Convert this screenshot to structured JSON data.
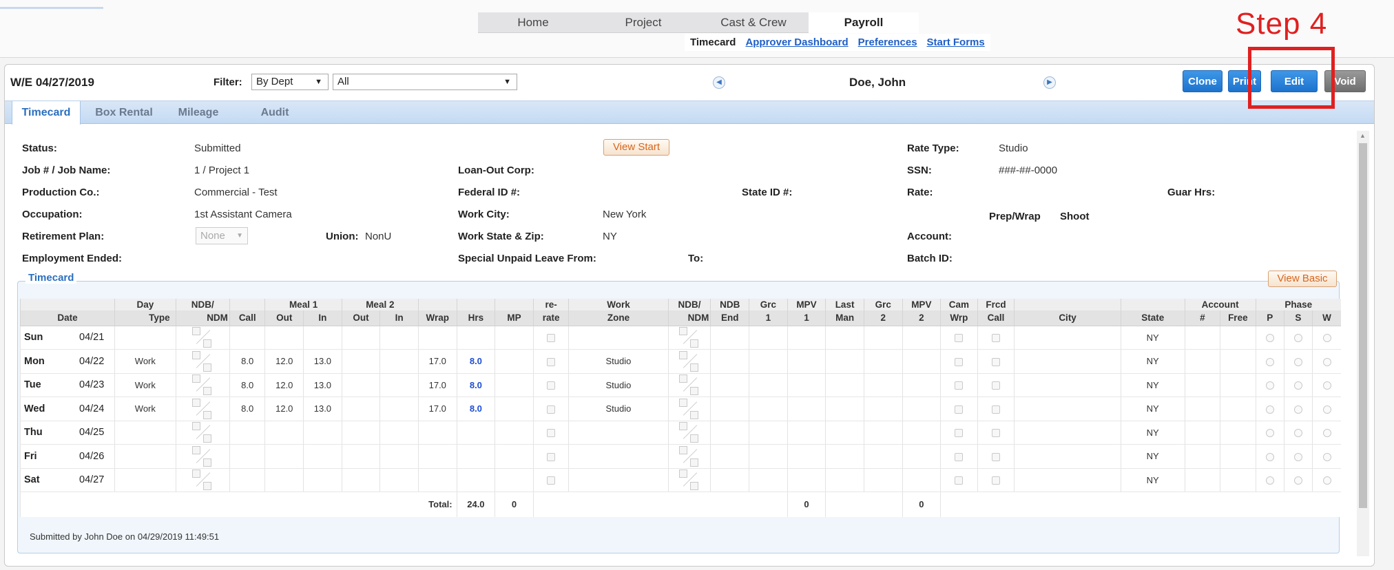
{
  "top_nav": {
    "tabs": [
      {
        "label": "Home",
        "active": false
      },
      {
        "label": "Project",
        "active": false
      },
      {
        "label": "Cast & Crew",
        "active": false
      },
      {
        "label": "Payroll",
        "active": true
      }
    ],
    "sub": {
      "current": "Timecard",
      "links": [
        "Approver Dashboard",
        "Preferences",
        "Start Forms"
      ]
    },
    "annotation": "Step 4"
  },
  "header": {
    "we_label": "W/E  04/27/2019",
    "filter_label": "Filter:",
    "filter_value": "By Dept",
    "filter2_value": "All",
    "employee_name": "Doe, John",
    "buttons": {
      "clone": "Clone",
      "print": "Print",
      "edit": "Edit",
      "void": "Void"
    }
  },
  "tabs": [
    "Timecard",
    "Box Rental",
    "Mileage",
    "Audit"
  ],
  "info": {
    "status_label": "Status:",
    "status": "Submitted",
    "job_label": "Job # / Job Name:",
    "job": "1 / Project 1",
    "prodco_label": "Production Co.:",
    "prodco": "Commercial - Test",
    "occupation_label": "Occupation:",
    "occupation": "1st Assistant Camera",
    "retirement_label": "Retirement Plan:",
    "retirement": "None",
    "union_label": "Union:",
    "union": "NonU",
    "employment_ended_label": "Employment Ended:",
    "view_start": "View Start",
    "loanout_label": "Loan-Out Corp:",
    "fedid_label": "Federal ID #:",
    "stateid_label": "State ID #:",
    "workcity_label": "Work City:",
    "workcity": "New York",
    "workstate_label": "Work State & Zip:",
    "workstate": "NY",
    "leave_label": "Special Unpaid Leave From:",
    "to_label": "To:",
    "ratetype_label": "Rate Type:",
    "ratetype": "Studio",
    "ssn_label": "SSN:",
    "ssn": "###-##-0000",
    "rate_label": "Rate:",
    "guar_label": "Guar Hrs:",
    "prepwrap_label": "Prep/Wrap",
    "shoot_label": "Shoot",
    "account_label": "Account:",
    "batch_label": "Batch ID:"
  },
  "timecard": {
    "legend": "Timecard",
    "view_basic": "View Basic",
    "head1": [
      "",
      "Day",
      "NDB/",
      "",
      "Meal 1",
      "Meal 2",
      "",
      "",
      "",
      "re-",
      "Work",
      "NDB/",
      "NDB",
      "Grc",
      "MPV",
      "Last",
      "Grc",
      "MPV",
      "Cam",
      "Frcd",
      "",
      "",
      "Account",
      "Phase"
    ],
    "head2": [
      "Date",
      "Type",
      "NDM",
      "Call",
      "Out",
      "In",
      "Out",
      "In",
      "Wrap",
      "Hrs",
      "MP",
      "rate",
      "Zone",
      "NDM",
      "End",
      "1",
      "1",
      "Man",
      "2",
      "2",
      "Wrp",
      "Call",
      "City",
      "State",
      "#",
      "Free",
      "P",
      "S",
      "W"
    ],
    "rows": [
      {
        "day": "Sun",
        "date": "04/21",
        "type": "",
        "call": "",
        "m1out": "",
        "m1in": "",
        "wrap": "",
        "hrs": "",
        "zone": "",
        "state": "NY"
      },
      {
        "day": "Mon",
        "date": "04/22",
        "type": "Work",
        "call": "8.0",
        "m1out": "12.0",
        "m1in": "13.0",
        "wrap": "17.0",
        "hrs": "8.0",
        "zone": "Studio",
        "state": "NY"
      },
      {
        "day": "Tue",
        "date": "04/23",
        "type": "Work",
        "call": "8.0",
        "m1out": "12.0",
        "m1in": "13.0",
        "wrap": "17.0",
        "hrs": "8.0",
        "zone": "Studio",
        "state": "NY"
      },
      {
        "day": "Wed",
        "date": "04/24",
        "type": "Work",
        "call": "8.0",
        "m1out": "12.0",
        "m1in": "13.0",
        "wrap": "17.0",
        "hrs": "8.0",
        "zone": "Studio",
        "state": "NY"
      },
      {
        "day": "Thu",
        "date": "04/25",
        "type": "",
        "call": "",
        "m1out": "",
        "m1in": "",
        "wrap": "",
        "hrs": "",
        "zone": "",
        "state": "NY"
      },
      {
        "day": "Fri",
        "date": "04/26",
        "type": "",
        "call": "",
        "m1out": "",
        "m1in": "",
        "wrap": "",
        "hrs": "",
        "zone": "",
        "state": "NY"
      },
      {
        "day": "Sat",
        "date": "04/27",
        "type": "",
        "call": "",
        "m1out": "",
        "m1in": "",
        "wrap": "",
        "hrs": "",
        "zone": "",
        "state": "NY"
      }
    ],
    "totals": {
      "label": "Total:",
      "hrs": "24.0",
      "mp": "0",
      "mpv1": "0",
      "mpv2": "0"
    },
    "submitted_text": "Submitted by John Doe on 04/29/2019 11:49:51"
  }
}
